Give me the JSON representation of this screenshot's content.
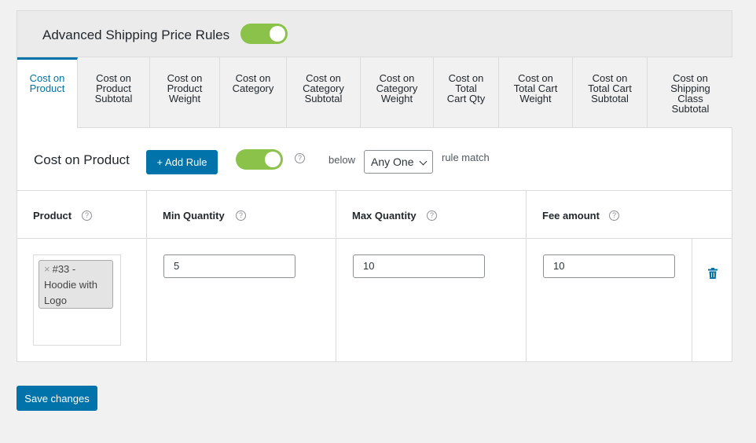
{
  "header": {
    "title": "Advanced Shipping Price Rules",
    "enabled": true
  },
  "tabs": [
    {
      "label": "Cost on\nProduct",
      "active": true
    },
    {
      "label": "Cost on\nProduct\nSubtotal",
      "active": false
    },
    {
      "label": "Cost on\nProduct\nWeight",
      "active": false
    },
    {
      "label": "Cost on\nCategory",
      "active": false
    },
    {
      "label": "Cost on\nCategory\nSubtotal",
      "active": false
    },
    {
      "label": "Cost on\nCategory\nWeight",
      "active": false
    },
    {
      "label": "Cost on\nTotal\nCart Qty",
      "active": false
    },
    {
      "label": "Cost on\nTotal Cart\nWeight",
      "active": false
    },
    {
      "label": "Cost on\nTotal Cart\nSubtotal",
      "active": false
    },
    {
      "label": "Cost on\nShipping\nClass\nSubtotal",
      "active": false
    }
  ],
  "section": {
    "title": "Cost on Product",
    "add_rule_label": "+ Add Rule",
    "enabled": true,
    "help_icon": "?",
    "below_label": "below",
    "match_select": "Any One",
    "rule_match_label": "rule match"
  },
  "table": {
    "headers": [
      "Product",
      "Min Quantity",
      "Max Quantity",
      "Fee amount"
    ],
    "rows": [
      {
        "product_chip_remove": "×",
        "product": "#33 - Hoodie with Logo",
        "min_quantity": "5",
        "max_quantity": "10",
        "fee_amount": "10"
      }
    ]
  },
  "footer": {
    "save_label": "Save changes"
  },
  "colors": {
    "accent": "#0073aa",
    "toggle_on": "#8bc34a"
  },
  "icons": {
    "help": "help-icon",
    "delete": "trash-icon",
    "dropdown": "chevron-down-icon"
  }
}
